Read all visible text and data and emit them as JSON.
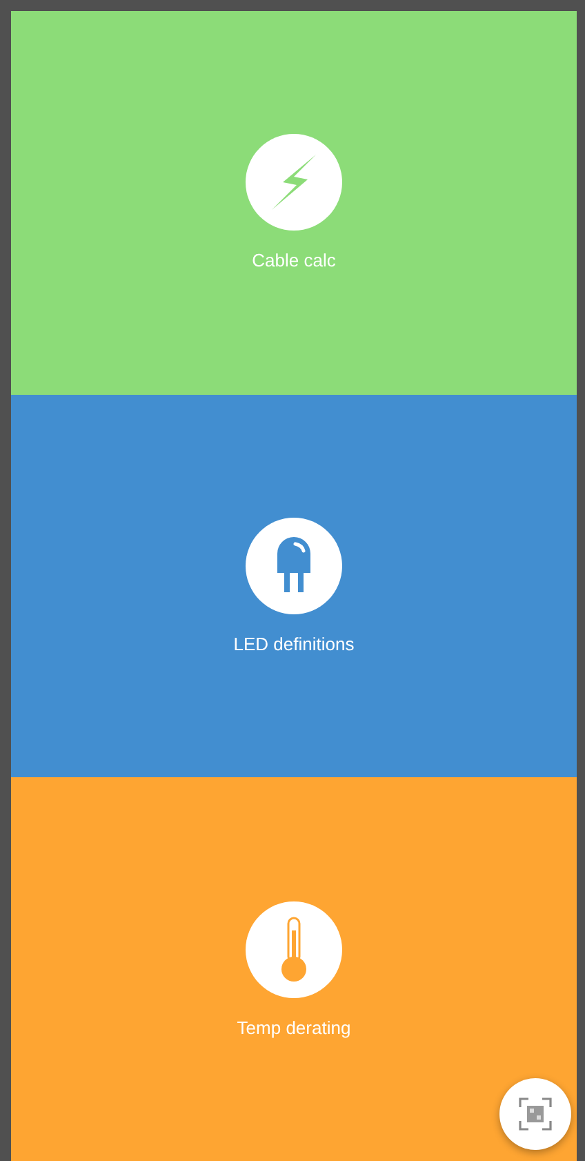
{
  "tiles": [
    {
      "kind": "bolt",
      "label": "Cable calc",
      "color": "#8cdc78"
    },
    {
      "kind": "led",
      "label": "LED definitions",
      "color": "#428ed0"
    },
    {
      "kind": "thermometer",
      "label": "Temp derating",
      "color": "#fea532"
    }
  ],
  "fab": {
    "kind": "qr-scan"
  }
}
